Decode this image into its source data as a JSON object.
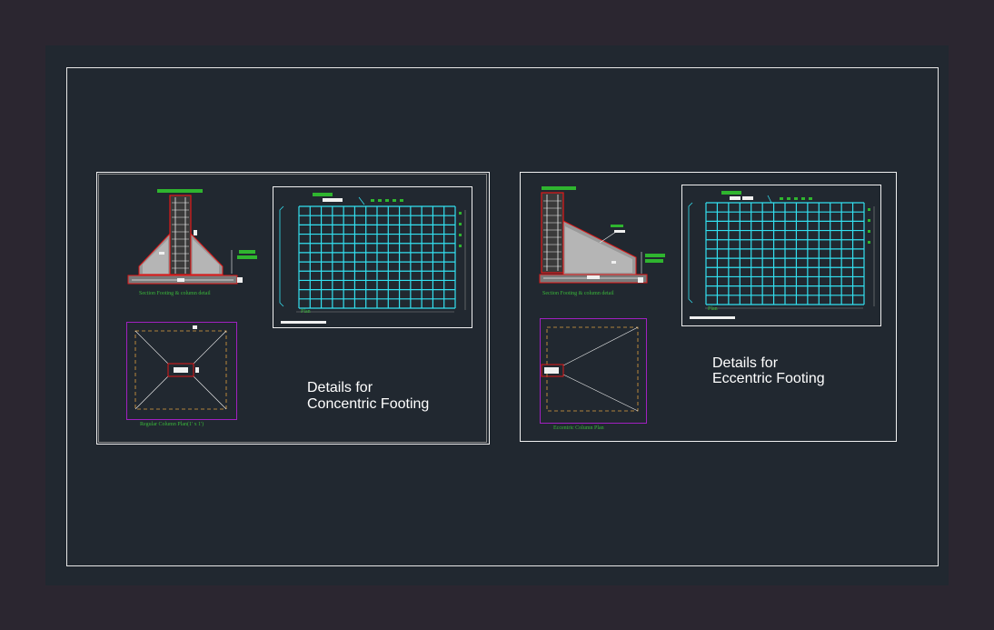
{
  "colors": {
    "background": "#2b2630",
    "viewport": "#212830",
    "border": "#e8e8e8",
    "mesh": "#33e0f0",
    "rebar": "#e01818",
    "concrete": "#d8d8d8",
    "annotation_green": "#2fb52f",
    "plan_outline": "#a020c0",
    "footing_edge": "#e0a040"
  },
  "concentric": {
    "title_line1": "Details for",
    "title_line2": "Concentric Footing",
    "section_caption": "Section Footing & column detail",
    "plan_caption": "Regular Column Plan(1' x 1')",
    "mesh_caption": "Plan"
  },
  "eccentric": {
    "title_line1": "Details for",
    "title_line2": "Eccentric Footing",
    "section_caption": "Section Footing & column detail",
    "plan_caption": "Eccentric Column Plan",
    "mesh_caption": "Plan"
  }
}
